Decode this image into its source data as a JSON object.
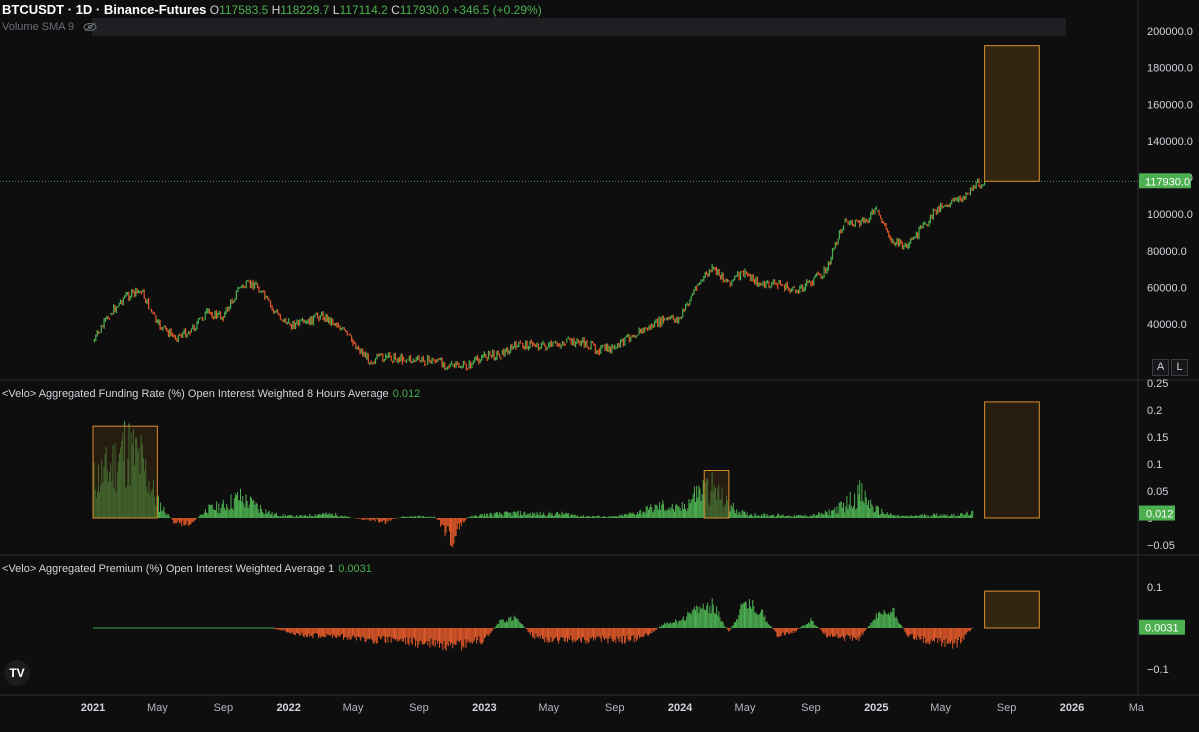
{
  "header": {
    "symbol": "BTCUSDT · 1D · Binance-Futures",
    "o_label": "O",
    "o_value": "117583.5",
    "h_label": "H",
    "h_value": "118229.7",
    "l_label": "L",
    "l_value": "117114.2",
    "c_label": "C",
    "c_value": "117930.0",
    "change": "+346.5 (+0.29%)"
  },
  "volume_label": "Volume SMA 9",
  "panes": {
    "funding": {
      "title": "<Velo> Aggregated Funding Rate (%) Open Interest Weighted 8 Hours Average",
      "value": "0.012"
    },
    "premium": {
      "title": "<Velo> Aggregated Premium (%) Open Interest Weighted Average 1",
      "value": "0.0031"
    }
  },
  "buttons": {
    "a": "A",
    "l": "L"
  },
  "logo": "TV",
  "colors": {
    "up": "#4caf50",
    "down": "#e0592a",
    "box_stroke": "#d9902f",
    "box_fill": "#3a2a12",
    "background": "#0e0e0e",
    "price_tag": "#4caf50"
  },
  "chart_data": [
    {
      "type": "line",
      "name": "BTCUSDT price",
      "y_axis_ticks": [
        "200000.0",
        "180000.0",
        "160000.0",
        "140000.0",
        "120000.0",
        "100000.0",
        "80000.0",
        "60000.0",
        "40000.0"
      ],
      "ylim": [
        20000,
        200000
      ],
      "x_ticks": [
        "2021",
        "May",
        "Sep",
        "2022",
        "May",
        "Sep",
        "2023",
        "May",
        "Sep",
        "2024",
        "May",
        "Sep",
        "2025",
        "May",
        "Sep",
        "2026",
        "Ma"
      ],
      "last_price_label": "117930.0",
      "last_price": 117930,
      "x": [
        "2021-01",
        "2021-02",
        "2021-03",
        "2021-04",
        "2021-05",
        "2021-06",
        "2021-07",
        "2021-08",
        "2021-09",
        "2021-10",
        "2021-11",
        "2021-12",
        "2022-01",
        "2022-02",
        "2022-03",
        "2022-04",
        "2022-05",
        "2022-06",
        "2022-07",
        "2022-08",
        "2022-09",
        "2022-10",
        "2022-11",
        "2022-12",
        "2023-01",
        "2023-02",
        "2023-03",
        "2023-04",
        "2023-05",
        "2023-06",
        "2023-07",
        "2023-08",
        "2023-09",
        "2023-10",
        "2023-11",
        "2023-12",
        "2024-01",
        "2024-02",
        "2024-03",
        "2024-04",
        "2024-05",
        "2024-06",
        "2024-07",
        "2024-08",
        "2024-09",
        "2024-10",
        "2024-11",
        "2024-12",
        "2025-01",
        "2025-02",
        "2025-03",
        "2025-04",
        "2025-05",
        "2025-06",
        "2025-07",
        "2025-07-22"
      ],
      "values": [
        30000,
        45000,
        55000,
        58000,
        40000,
        33000,
        36000,
        46000,
        44000,
        60000,
        62000,
        48000,
        40000,
        40000,
        45000,
        40000,
        30000,
        20000,
        22000,
        21000,
        20000,
        20000,
        17000,
        16800,
        23000,
        23500,
        28000,
        29000,
        27500,
        30000,
        30000,
        26000,
        26500,
        34000,
        37500,
        42000,
        43000,
        61000,
        70000,
        63000,
        68000,
        61000,
        62000,
        58000,
        63000,
        70000,
        96000,
        94000,
        102000,
        85000,
        82000,
        94000,
        105000,
        107000,
        115000,
        117930
      ],
      "annotation_box": {
        "x0": "2025-07-22",
        "x1": "2025-11",
        "y0": 117930,
        "y1": 192000
      }
    },
    {
      "type": "bar",
      "name": "Funding Rate",
      "y_axis_ticks": [
        "0.25",
        "0.2",
        "0.15",
        "0.1",
        "0.05",
        "0",
        "-0.05"
      ],
      "ylim": [
        -0.06,
        0.25
      ],
      "last_value_label": "0.012",
      "x": [
        "2021-01",
        "2021-02",
        "2021-03",
        "2021-04",
        "2021-05",
        "2021-06",
        "2021-07",
        "2021-08",
        "2021-09",
        "2021-10",
        "2021-11",
        "2021-12",
        "2022-01",
        "2022-02",
        "2022-03",
        "2022-04",
        "2022-05",
        "2022-06",
        "2022-07",
        "2022-08",
        "2022-09",
        "2022-10",
        "2022-11",
        "2022-12",
        "2023-01",
        "2023-02",
        "2023-03",
        "2023-04",
        "2023-05",
        "2023-06",
        "2023-07",
        "2023-08",
        "2023-09",
        "2023-10",
        "2023-11",
        "2023-12",
        "2024-01",
        "2024-02",
        "2024-03",
        "2024-04",
        "2024-05",
        "2024-06",
        "2024-07",
        "2024-08",
        "2024-09",
        "2024-10",
        "2024-11",
        "2024-12",
        "2025-01",
        "2025-02",
        "2025-03",
        "2025-04",
        "2025-05",
        "2025-06",
        "2025-07"
      ],
      "values": [
        0.09,
        0.12,
        0.17,
        0.14,
        0.04,
        -0.01,
        -0.015,
        0.02,
        0.03,
        0.05,
        0.03,
        0.01,
        0.005,
        0.005,
        0.01,
        0.008,
        0.0,
        -0.005,
        -0.01,
        0.003,
        0.004,
        0.002,
        -0.05,
        0.002,
        0.008,
        0.01,
        0.012,
        0.01,
        0.01,
        0.01,
        0.005,
        0.004,
        0.003,
        0.01,
        0.02,
        0.03,
        0.02,
        0.06,
        0.075,
        0.03,
        0.01,
        0.008,
        0.007,
        0.005,
        0.006,
        0.012,
        0.03,
        0.06,
        0.02,
        0.006,
        0.004,
        0.007,
        0.008,
        0.007,
        0.012
      ],
      "annotation_boxes": [
        {
          "x0": "2021-01",
          "x1": "2021-05",
          "y0": 0,
          "y1": 0.17
        },
        {
          "x0": "2024-02-15",
          "x1": "2024-04",
          "y0": 0,
          "y1": 0.088
        },
        {
          "x0": "2025-07-22",
          "x1": "2025-11",
          "y0": 0,
          "y1": 0.215
        }
      ]
    },
    {
      "type": "bar",
      "name": "Premium",
      "y_axis_ticks": [
        "0.1",
        "0",
        "-0.1"
      ],
      "ylim": [
        -0.13,
        0.13
      ],
      "last_value_label": "0.0031",
      "x": [
        "2021-01",
        "2021-02",
        "2021-03",
        "2021-04",
        "2021-05",
        "2021-06",
        "2021-07",
        "2021-08",
        "2021-09",
        "2021-10",
        "2021-11",
        "2021-12",
        "2022-01",
        "2022-02",
        "2022-03",
        "2022-04",
        "2022-05",
        "2022-06",
        "2022-07",
        "2022-08",
        "2022-09",
        "2022-10",
        "2022-11",
        "2022-12",
        "2023-01",
        "2023-02",
        "2023-03",
        "2023-04",
        "2023-05",
        "2023-06",
        "2023-07",
        "2023-08",
        "2023-09",
        "2023-10",
        "2023-11",
        "2023-12",
        "2024-01",
        "2024-02",
        "2024-03",
        "2024-04",
        "2024-05",
        "2024-06",
        "2024-07",
        "2024-08",
        "2024-09",
        "2024-10",
        "2024-11",
        "2024-12",
        "2025-01",
        "2025-02",
        "2025-03",
        "2025-04",
        "2025-05",
        "2025-06",
        "2025-07"
      ],
      "values": [
        0,
        0,
        0,
        0,
        0,
        0,
        0,
        0,
        0,
        0,
        0,
        0,
        -0.01,
        -0.02,
        -0.02,
        -0.02,
        -0.025,
        -0.03,
        -0.03,
        -0.03,
        -0.04,
        -0.04,
        -0.055,
        -0.04,
        -0.03,
        0.02,
        0.025,
        -0.02,
        -0.03,
        -0.03,
        -0.03,
        -0.03,
        -0.03,
        -0.03,
        -0.02,
        0.01,
        0.02,
        0.045,
        0.06,
        -0.01,
        0.065,
        0.04,
        -0.02,
        -0.01,
        0.02,
        -0.02,
        -0.025,
        -0.025,
        0.03,
        0.045,
        -0.02,
        -0.03,
        -0.035,
        -0.04,
        0.003
      ],
      "annotation_box": {
        "x0": "2025-07-22",
        "x1": "2025-11",
        "y0": 0,
        "y1": 0.09
      }
    }
  ]
}
